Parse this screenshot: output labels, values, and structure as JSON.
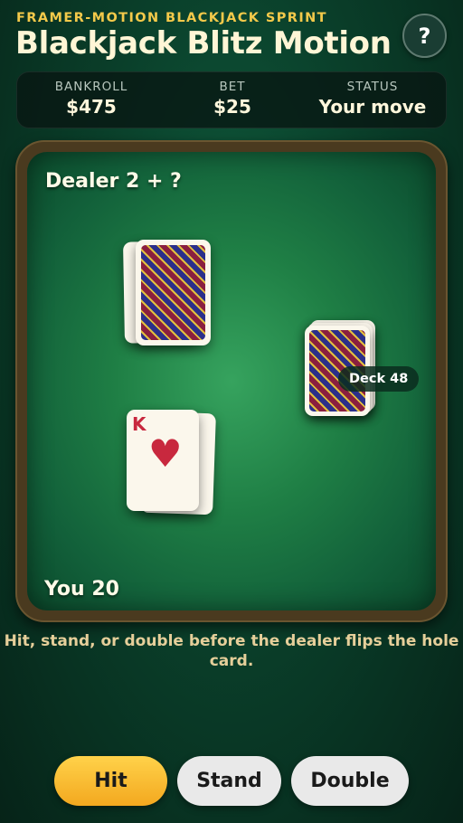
{
  "header": {
    "subtitle": "FRAMER-MOTION BLACKJACK SPRINT",
    "title": "Blackjack Blitz Motion",
    "help_label": "?"
  },
  "stats": {
    "bankroll_label": "BANKROLL",
    "bankroll_value": "$475",
    "bet_label": "BET",
    "bet_value": "$25",
    "status_label": "STATUS",
    "status_value": "Your move"
  },
  "table": {
    "dealer_label": "Dealer 2 + ?",
    "player_label": "You 20",
    "deck_label": "Deck 48",
    "player_top_card": {
      "rank": "K",
      "suit": "♥"
    }
  },
  "hint": "Hit, stand, or double before the dealer flips the hole card.",
  "actions": {
    "hit": "Hit",
    "stand": "Stand",
    "double": "Double"
  },
  "colors": {
    "accent": "#f3c94a",
    "felt": "#1f7f45",
    "rail": "#4a3a1f",
    "hit_button": "#f3a81f",
    "card_red": "#c8283e"
  },
  "icons": {
    "help": "question-mark-icon",
    "suit": "heart-icon"
  }
}
